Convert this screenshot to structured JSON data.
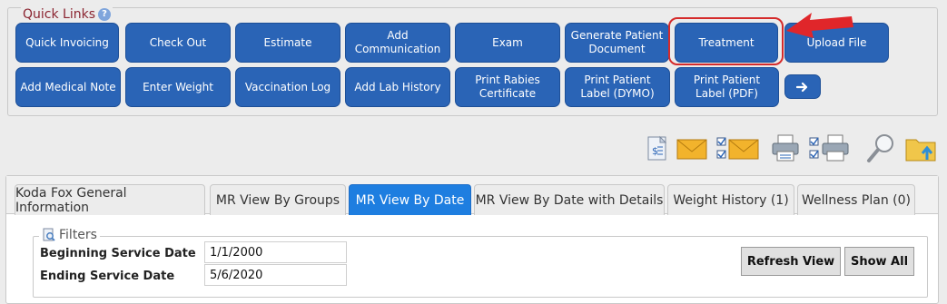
{
  "quick_links": {
    "title": "Quick Links",
    "row1": [
      "Quick Invoicing",
      "Check Out",
      "Estimate",
      "Add Communication",
      "Exam",
      "Generate Patient Document",
      "Treatment",
      "Upload File"
    ],
    "row2": [
      "Add Medical Note",
      "Enter Weight",
      "Vaccination Log",
      "Add Lab History",
      "Print Rabies Certificate",
      "Print Patient Label (DYMO)",
      "Print Patient Label (PDF)"
    ],
    "next_icon": "arrow-right-icon",
    "highlight": "Treatment"
  },
  "toolbar": {
    "icons": [
      "invoice-icon",
      "email-icon",
      "checklist-email-icon",
      "printer-icon",
      "checklist-printer-icon",
      "magnifier-icon",
      "folder-upload-icon"
    ]
  },
  "tabs": [
    {
      "label": "Koda Fox General Information",
      "active": false
    },
    {
      "label": "MR View By Groups",
      "active": false
    },
    {
      "label": "MR View By Date",
      "active": true
    },
    {
      "label": "MR View By Date with Details",
      "active": false
    },
    {
      "label": "Weight History (1)",
      "active": false
    },
    {
      "label": "Wellness Plan (0)",
      "active": false
    }
  ],
  "filters": {
    "title": "Filters",
    "beginning_label": "Beginning Service Date",
    "beginning_value": "1/1/2000",
    "ending_label": "Ending Service Date",
    "ending_value": "5/6/2020",
    "refresh_label": "Refresh View",
    "show_all_label": "Show All"
  },
  "colors": {
    "button_blue": "#2a64b6",
    "active_tab": "#1e7ee0",
    "legend_red": "#8a2430",
    "highlight_red": "#d52b2b"
  }
}
